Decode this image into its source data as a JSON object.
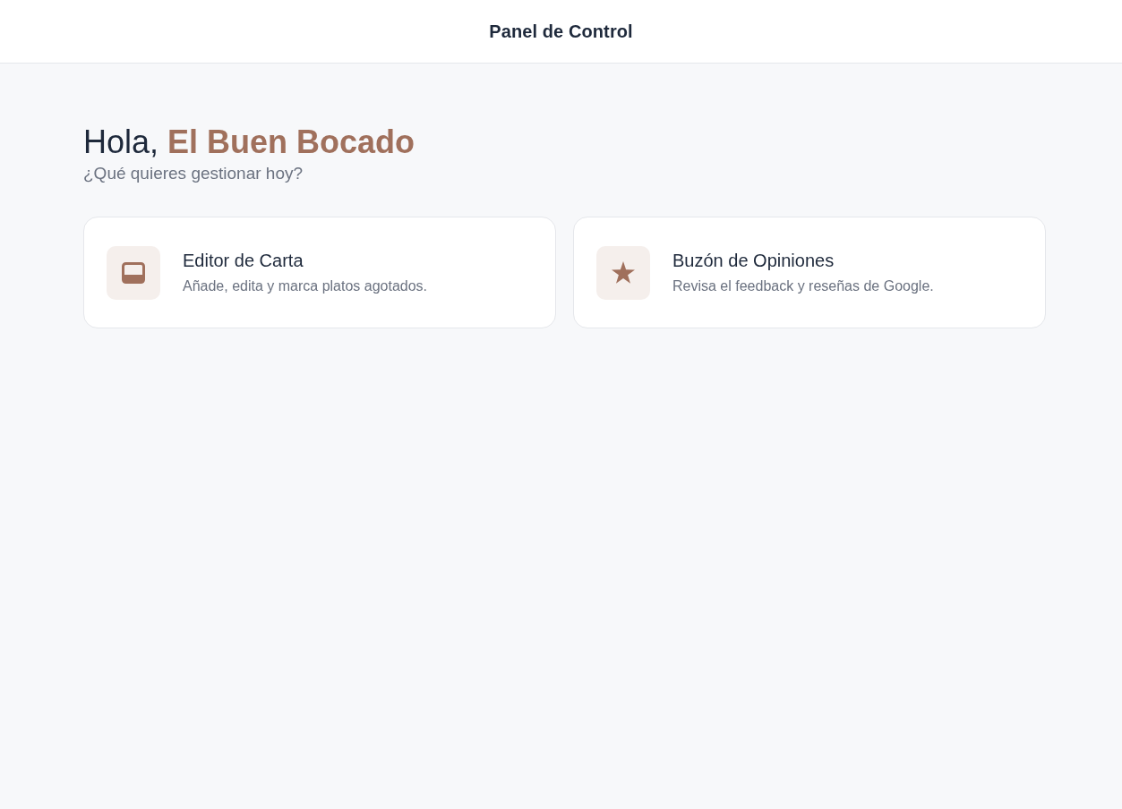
{
  "header": {
    "title": "Panel de Control"
  },
  "greeting": {
    "text": "Hola, **El Buen Bocado**",
    "subtitle": "¿Qué quieres gestionar hoy?"
  },
  "cards": [
    {
      "kind": "editor",
      "title": "Editor de Carta",
      "description": "Añade, edita y marca platos agotados."
    },
    {
      "kind": "reviews",
      "title": "Buzón de Opiniones",
      "description": "Revisa el feedback y reseñas de Google."
    }
  ]
}
